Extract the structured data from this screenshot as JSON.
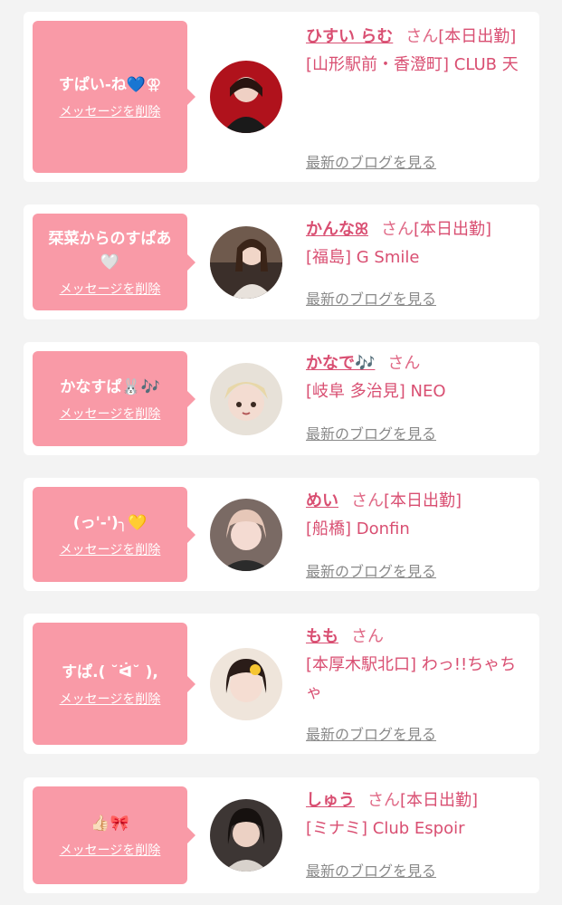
{
  "delete_label": "メッセージを削除",
  "san_label": "さん",
  "blog_label": "最新のブログを見る",
  "cards": [
    {
      "message": "すぱい-ね💙⚢",
      "name": "ひすい らむ",
      "status": "[本日出勤]",
      "shop": "[山形駅前・香澄町] CLUB 天"
    },
    {
      "message": "栞菜からのすぱあ🤍",
      "name": "かんなꕤ",
      "status": "[本日出勤]",
      "shop": "[福島] G Smile"
    },
    {
      "message": "かなすぱ🐰🎶",
      "name": "かなで🎶",
      "status": "",
      "shop": "[岐阜 多治見] NEO"
    },
    {
      "message": "(っ'-')╮💛",
      "name": "めい",
      "status": "[本日出勤]",
      "shop": "[船橋] Donfin"
    },
    {
      "message": "すぱ.( ˘ᐛ˘ ),",
      "name": "もも",
      "status": "",
      "shop": "[本厚木駅北口] わっ!!ちゃちゃ"
    },
    {
      "message": "👍🏻🎀",
      "name": "しゅう",
      "status": "[本日出勤]",
      "shop": "[ミナミ] Club Espoir"
    }
  ]
}
